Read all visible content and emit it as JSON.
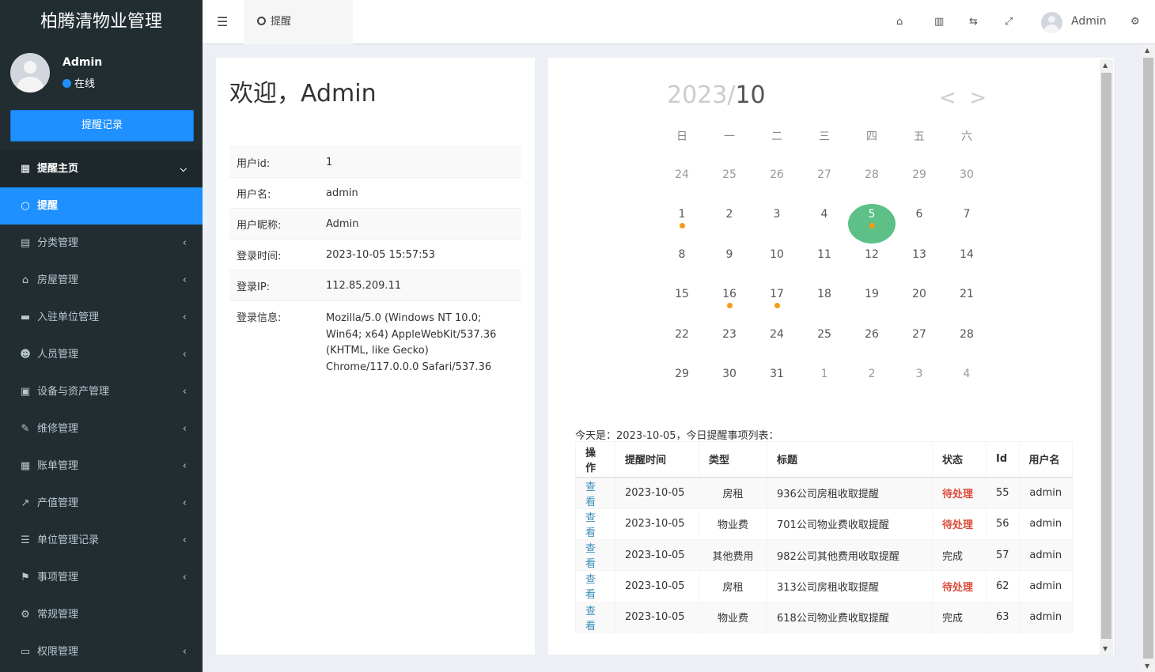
{
  "app": {
    "title": "柏腾清物业管理"
  },
  "user": {
    "name": "Admin",
    "status": "在线"
  },
  "sidebar": {
    "reminder_button": "提醒记录",
    "items": [
      {
        "label": "提醒主页",
        "icon": "calendar-icon",
        "arrow": "⌄"
      },
      {
        "label": "提醒",
        "icon": "circle-icon"
      },
      {
        "label": "分类管理",
        "icon": "book-icon",
        "arrow": "‹"
      },
      {
        "label": "房屋管理",
        "icon": "home-icon",
        "arrow": "‹"
      },
      {
        "label": "入驻单位管理",
        "icon": "briefcase-icon",
        "arrow": "‹"
      },
      {
        "label": "人员管理",
        "icon": "users-icon",
        "arrow": "‹"
      },
      {
        "label": "设备与资产管理",
        "icon": "list-alt-icon",
        "arrow": "‹"
      },
      {
        "label": "维修管理",
        "icon": "wrench-icon",
        "arrow": "‹"
      },
      {
        "label": "账单管理",
        "icon": "calculator-icon",
        "arrow": "‹"
      },
      {
        "label": "产值管理",
        "icon": "line-chart-icon",
        "arrow": "‹"
      },
      {
        "label": "单位管理记录",
        "icon": "bars-icon",
        "arrow": "‹"
      },
      {
        "label": "事项管理",
        "icon": "flag-icon",
        "arrow": "‹"
      },
      {
        "label": "常规管理",
        "icon": "cogs-icon"
      },
      {
        "label": "权限管理",
        "icon": "desktop-icon",
        "arrow": "‹"
      }
    ]
  },
  "topbar": {
    "tab_label": "提醒",
    "username": "Admin"
  },
  "welcome": {
    "title": "欢迎，Admin",
    "rows": [
      {
        "key": "用户id:",
        "value": "1"
      },
      {
        "key": "用户名:",
        "value": "admin"
      },
      {
        "key": "用户昵称:",
        "value": "Admin"
      },
      {
        "key": "登录时间:",
        "value": "2023-10-05 15:57:53"
      },
      {
        "key": "登录IP:",
        "value": "112.85.209.11"
      },
      {
        "key": "登录信息:",
        "value": "Mozilla/5.0 (Windows NT 10.0; Win64; x64) AppleWebKit/537.36 (KHTML, like Gecko) Chrome/117.0.0.0 Safari/537.36"
      }
    ]
  },
  "calendar": {
    "year": "2023/",
    "month": "10",
    "prev": "<",
    "next": ">",
    "weekdays": [
      "日",
      "一",
      "二",
      "三",
      "四",
      "五",
      "六"
    ],
    "weeks": [
      [
        "24",
        "25",
        "26",
        "27",
        "28",
        "29",
        "30"
      ],
      [
        "1",
        "2",
        "3",
        "4",
        "5",
        "6",
        "7"
      ],
      [
        "8",
        "9",
        "10",
        "11",
        "12",
        "13",
        "14"
      ],
      [
        "15",
        "16",
        "17",
        "18",
        "19",
        "20",
        "21"
      ],
      [
        "22",
        "23",
        "24",
        "25",
        "26",
        "27",
        "28"
      ],
      [
        "29",
        "30",
        "31",
        "1",
        "2",
        "3",
        "4"
      ]
    ],
    "today_cell": [
      1,
      4
    ],
    "event_cells": [
      [
        1,
        0
      ],
      [
        1,
        4
      ],
      [
        3,
        1
      ],
      [
        3,
        2
      ]
    ],
    "other_month_cells": [
      [
        0,
        0
      ],
      [
        0,
        1
      ],
      [
        0,
        2
      ],
      [
        0,
        3
      ],
      [
        0,
        4
      ],
      [
        0,
        5
      ],
      [
        0,
        6
      ],
      [
        5,
        3
      ],
      [
        5,
        4
      ],
      [
        5,
        5
      ],
      [
        5,
        6
      ]
    ]
  },
  "reminders": {
    "caption": "今天是：2023-10-05，今日提醒事项列表：",
    "headers": [
      "操作",
      "提醒时间",
      "类型",
      "标题",
      "状态",
      "Id",
      "用户名"
    ],
    "rows": [
      {
        "action": "查看",
        "time": "2023-10-05",
        "type": "房租",
        "title": "936公司房租收取提醒",
        "status": "待处理",
        "id": "55",
        "user": "admin"
      },
      {
        "action": "查看",
        "time": "2023-10-05",
        "type": "物业费",
        "title": "701公司物业费收取提醒",
        "status": "待处理",
        "id": "56",
        "user": "admin"
      },
      {
        "action": "查看",
        "time": "2023-10-05",
        "type": "其他费用",
        "title": "982公司其他费用收取提醒",
        "status": "完成",
        "id": "57",
        "user": "admin"
      },
      {
        "action": "查看",
        "time": "2023-10-05",
        "type": "房租",
        "title": "313公司房租收取提醒",
        "status": "待处理",
        "id": "62",
        "user": "admin"
      },
      {
        "action": "查看",
        "time": "2023-10-05",
        "type": "物业费",
        "title": "618公司物业费收取提醒",
        "status": "完成",
        "id": "63",
        "user": "admin"
      }
    ]
  },
  "colors": {
    "primary": "#1e90ff",
    "sidebar": "#222d32",
    "today": "#5cc087",
    "event": "#f39c12",
    "pending": "#dd4b39",
    "link": "#3c8dbc"
  }
}
